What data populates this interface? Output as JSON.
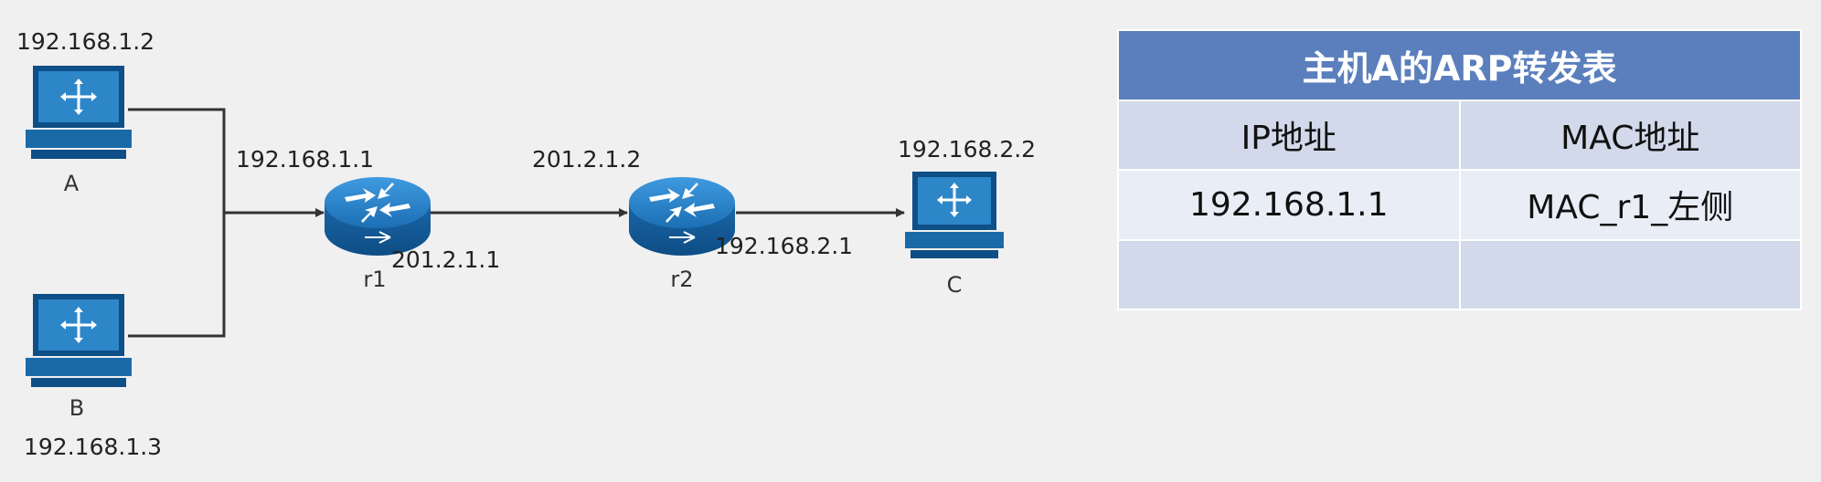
{
  "diagram": {
    "hosts": {
      "A": {
        "name": "A",
        "ip": "192.168.1.2"
      },
      "B": {
        "name": "B",
        "ip": "192.168.1.3"
      },
      "C": {
        "name": "C",
        "ip": "192.168.2.2"
      }
    },
    "routers": {
      "r1": {
        "name": "r1",
        "left_ip": "192.168.1.1",
        "right_ip": "201.2.1.1"
      },
      "r2": {
        "name": "r2",
        "left_ip": "201.2.1.2",
        "right_ip": "192.168.2.1"
      }
    },
    "colors": {
      "device_blue": "#1e73b8",
      "device_dark": "#0d4f86",
      "link": "#333333"
    }
  },
  "arp_table": {
    "title": "主机A的ARP转发表",
    "headers": [
      "IP地址",
      "MAC地址"
    ],
    "rows": [
      [
        "192.168.1.1",
        "MAC_r1_左侧"
      ],
      [
        "",
        ""
      ]
    ],
    "colors": {
      "title_bg": "#5b7fbd",
      "row_bg": "#d1d9ea"
    }
  }
}
